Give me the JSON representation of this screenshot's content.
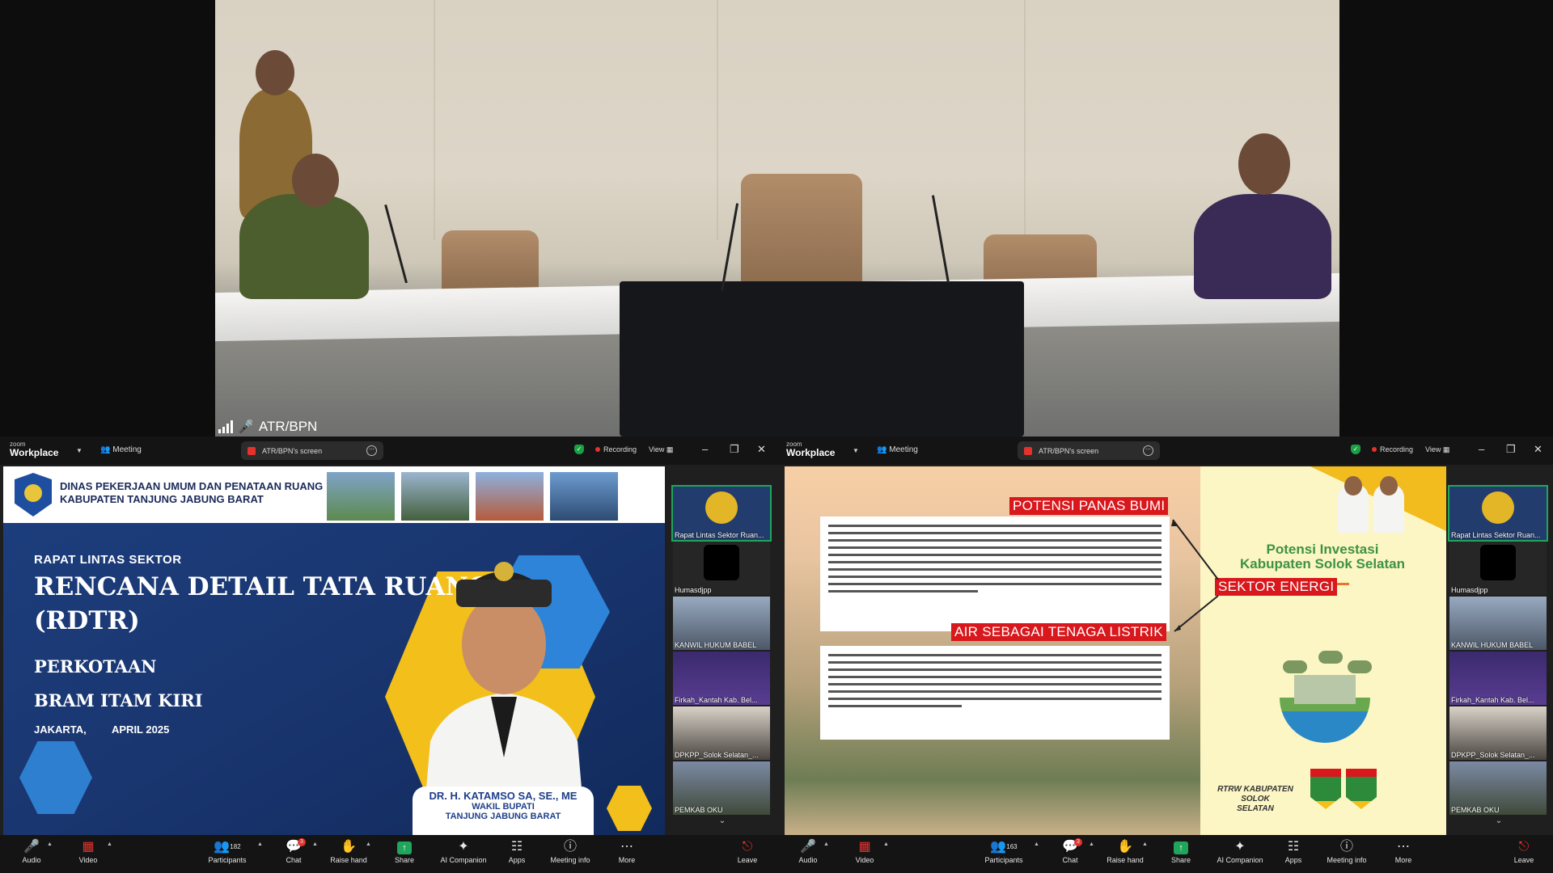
{
  "camera": {
    "label": "ATR/BPN"
  },
  "left_window": {
    "brand_small": "zoom",
    "brand_big": "Workplace",
    "meeting_label": "Meeting",
    "share_label": "ATR/BPN's screen",
    "recording_label": "Recording",
    "view_label": "View",
    "slide": {
      "org_line1": "DINAS PEKERJAAN UMUM DAN PENATAAN RUANG",
      "org_line2": "KABUPATEN TANJUNG JABUNG BARAT",
      "rapat": "RAPAT LINTAS SEKTOR",
      "title1": "RENCANA DETAIL TATA RUANG",
      "title2": "(RDTR)",
      "sub1": "PERKOTAAN",
      "sub2": "BRAM ITAM KIRI",
      "place": "JAKARTA,",
      "date": "APRIL 2025",
      "person_name": "DR. H. KATAMSO SA, SE., ME",
      "person_role1": "WAKIL BUPATI",
      "person_role2": "TANJUNG JABUNG BARAT"
    },
    "gallery": [
      "Rapat Lintas Sektor Ruan...",
      "Humasdjpp",
      "KANWIL HUKUM BABEL",
      "Firkah_Kantah Kab. Bel...",
      "DPKPP_Solok Selatan_...",
      "PEMKAB OKU"
    ],
    "toolbar": {
      "audio": "Audio",
      "video": "Video",
      "participants": "Participants",
      "participants_count": "182",
      "chat": "Chat",
      "chat_badge": "3",
      "raise_hand": "Raise hand",
      "share": "Share",
      "ai": "AI Companion",
      "apps": "Apps",
      "info": "Meeting info",
      "more": "More",
      "leave": "Leave"
    }
  },
  "right_window": {
    "brand_small": "zoom",
    "brand_big": "Workplace",
    "meeting_label": "Meeting",
    "share_label": "ATR/BPN's screen",
    "recording_label": "Recording",
    "view_label": "View",
    "slide": {
      "tag1": "POTENSI PANAS BUMI",
      "tag2": "SEKTOR ENERGI",
      "tag3": "AIR SEBAGAI TENAGA LISTRIK",
      "heading1": "Potensi Investasi",
      "heading2": "Kabupaten Solok Selatan",
      "footer1": "RTRW KABUPATEN SOLOK",
      "footer2": "SELATAN"
    },
    "gallery": [
      "Rapat Lintas Sektor Ruan...",
      "Humasdjpp",
      "KANWIL HUKUM BABEL",
      "Firkah_Kantah Kab. Bel...",
      "DPKPP_Solok Selatan_...",
      "PEMKAB OKU"
    ],
    "toolbar": {
      "audio": "Audio",
      "video": "Video",
      "participants": "Participants",
      "participants_count": "163",
      "chat": "Chat",
      "chat_badge": "3",
      "raise_hand": "Raise hand",
      "share": "Share",
      "ai": "AI Companion",
      "apps": "Apps",
      "info": "Meeting info",
      "more": "More",
      "leave": "Leave"
    }
  },
  "colors": {
    "zoom_green": "#1fa65a",
    "recording_red": "#e5322d",
    "slide_red": "#d8181c",
    "slide_navy": "#1c3f7e",
    "slide_yellow": "#f2bf1b"
  }
}
